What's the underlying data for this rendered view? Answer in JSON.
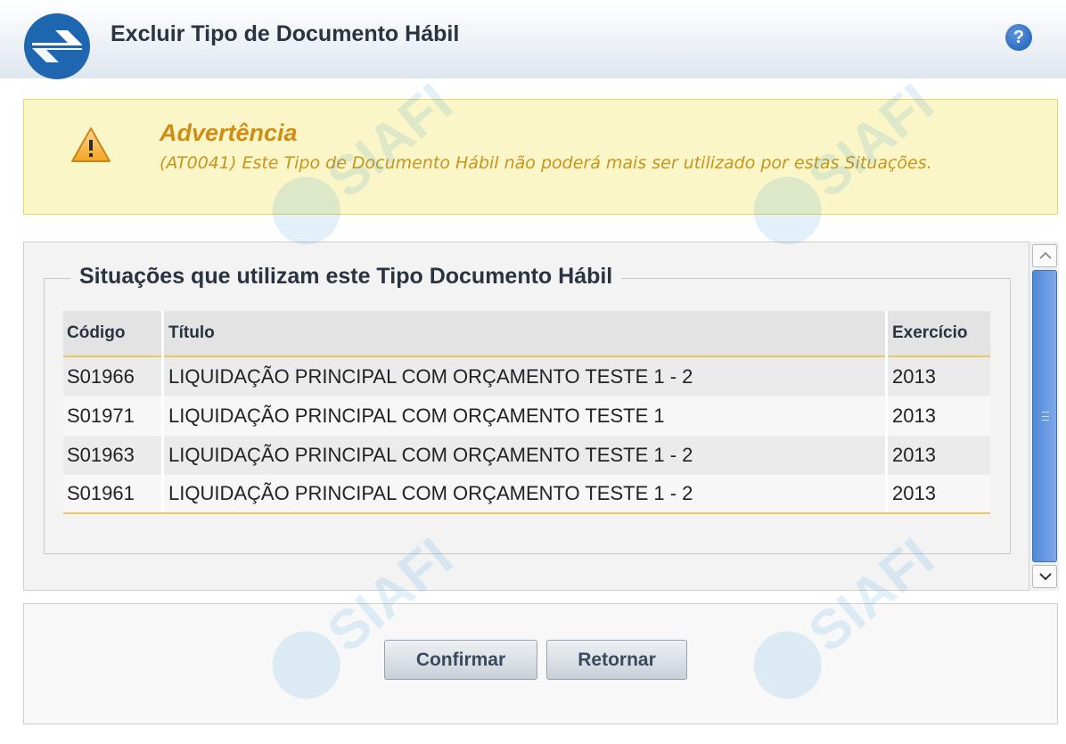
{
  "header": {
    "title": "Excluir Tipo de Documento Hábil",
    "help_icon": "?"
  },
  "warning": {
    "title": "Advertência",
    "message": "(AT0041) Este Tipo de Documento Hábil não poderá mais ser utilizado por estas Situações."
  },
  "situations": {
    "legend": "Situações que utilizam este Tipo Documento Hábil",
    "columns": [
      "Código",
      "Título",
      "Exercício"
    ],
    "rows": [
      {
        "codigo": "S01966",
        "titulo": "LIQUIDAÇÃO PRINCIPAL COM ORÇAMENTO TESTE 1 - 2",
        "exercicio": "2013"
      },
      {
        "codigo": "S01971",
        "titulo": "LIQUIDAÇÃO PRINCIPAL COM ORÇAMENTO TESTE 1",
        "exercicio": "2013"
      },
      {
        "codigo": "S01963",
        "titulo": "LIQUIDAÇÃO PRINCIPAL COM ORÇAMENTO TESTE 1 - 2",
        "exercicio": "2013"
      },
      {
        "codigo": "S01961",
        "titulo": "LIQUIDAÇÃO PRINCIPAL COM ORÇAMENTO TESTE 1 - 2",
        "exercicio": "2013"
      }
    ]
  },
  "footer": {
    "confirm_label": "Confirmar",
    "return_label": "Retornar"
  },
  "watermark": "SIAFI",
  "colors": {
    "warning_bg": "#fbf6c7",
    "warning_text": "#d08d14",
    "accent_line": "#e9c95a",
    "scroll_thumb": "#5b8fdc"
  }
}
